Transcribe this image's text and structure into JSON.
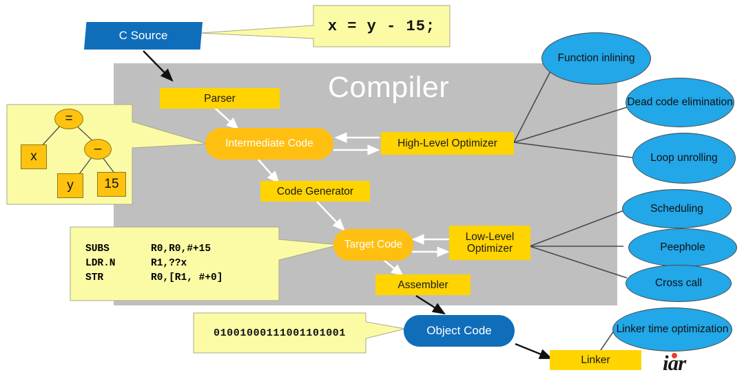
{
  "diagram": {
    "title": "Compiler",
    "source_box": {
      "label": "C Source"
    },
    "object_box": {
      "label": "Object Code"
    },
    "linker_box": {
      "label": "Linker"
    },
    "stages": {
      "parser": "Parser",
      "intermediate_code": "Intermediate Code",
      "code_generator": "Code Generator",
      "target_code": "Target Code",
      "assembler": "Assembler",
      "high_level_optimizer": "High-Level Optimizer",
      "low_level_optimizer": "Low-Level Optimizer"
    },
    "optimizations_high": [
      {
        "label": "Function inlining"
      },
      {
        "label": "Dead code elimination"
      },
      {
        "label": "Loop unrolling"
      }
    ],
    "optimizations_low": [
      {
        "label": "Scheduling"
      },
      {
        "label": "Peephole"
      },
      {
        "label": "Cross call"
      }
    ],
    "optimizations_link": [
      {
        "label": "Linker time optimization"
      }
    ],
    "callouts": {
      "c_code": "x = y - 15;",
      "binary": "01001000111001101001",
      "assembly": [
        {
          "mnemonic": "SUBS",
          "operands": "R0,R0,#+15"
        },
        {
          "mnemonic": "LDR.N",
          "operands": "R1,??x"
        },
        {
          "mnemonic": "STR",
          "operands": "R0,[R1, #+0]"
        }
      ],
      "ast": {
        "root": "=",
        "left_leaf": "x",
        "operator": "–",
        "right_left_leaf": "y",
        "right_right_leaf": "15"
      }
    },
    "logo": {
      "text": "iar"
    },
    "colors": {
      "panel_gray": "#bfbfbf",
      "stage_yellow": "#ffd400",
      "code_orange": "#ffbf10",
      "source_blue": "#106dba",
      "ellipse_blue": "#22a7e8",
      "callout_yellow": "#fbfba6",
      "logo_red": "#e8402a"
    }
  }
}
